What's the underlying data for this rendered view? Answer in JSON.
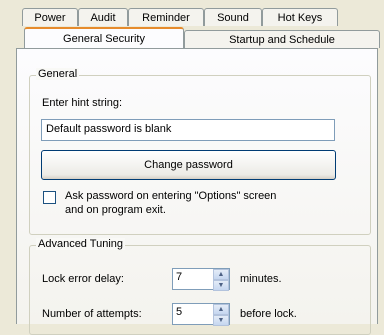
{
  "tabs_row_back": [
    "Power",
    "Audit",
    "Reminder",
    "Sound",
    "Hot Keys"
  ],
  "tabs_row_front": [
    "General Security",
    "Startup and Schedule"
  ],
  "active_tab": "General Security",
  "general": {
    "title": "General",
    "hint_label": "Enter hint string:",
    "hint_value": "Default password is blank",
    "change_button": "Change password",
    "ask_checkbox_line1": "Ask password on entering \"Options\" screen",
    "ask_checkbox_line2": "and on program exit.",
    "ask_checked": false
  },
  "advanced": {
    "title": "Advanced Tuning",
    "lock_delay_label": "Lock error delay:",
    "lock_delay_value": "7",
    "lock_delay_unit": "minutes.",
    "attempts_label": "Number of attempts:",
    "attempts_value": "5",
    "attempts_unit": "before lock."
  }
}
